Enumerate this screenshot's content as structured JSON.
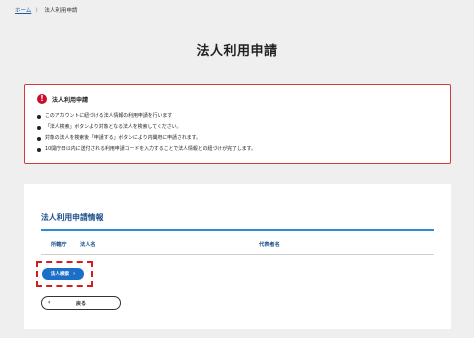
{
  "breadcrumb": {
    "home": "ホーム",
    "separator": "〉",
    "current": "法人利用申請"
  },
  "page_title": "法人利用申請",
  "notice": {
    "icon": "!",
    "title": "法人利用申請",
    "items": [
      "このアカウントに紐づける法人情報の利用申請を行います",
      "「法人検索」ボタンより対象となる法人を検索してください。",
      "対象の法人を検索後「申請する」ボタンにより内閣府に申請されます。",
      "10開庁日以内に送付される利用申請コードを入力することで法人情報との紐づけが完了します。"
    ]
  },
  "card": {
    "title": "法人利用申請情報",
    "columns": {
      "office": "所轄庁",
      "corp_name": "法人名",
      "representative": "代表者名"
    },
    "search_button": "法人検索",
    "search_chevron": "›",
    "back_button": "戻る",
    "back_chevron": "‹"
  },
  "colors": {
    "accent": "#1c6fc7",
    "alert": "#c8102e",
    "highlight": "#d21e1e",
    "heading": "#1a4e8a"
  }
}
